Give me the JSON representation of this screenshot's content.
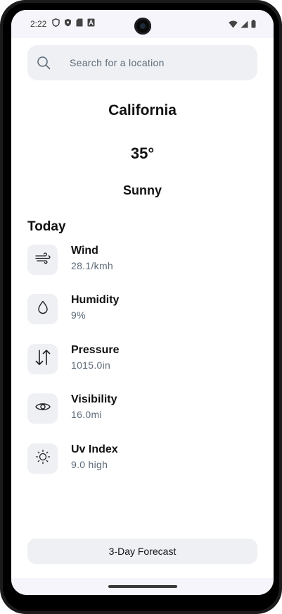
{
  "status_bar": {
    "time": "2:22",
    "left_icons": [
      "shield-outline-icon",
      "shield-filled-icon",
      "sd-card-icon",
      "font-a-icon"
    ],
    "right_icons": [
      "wifi-icon",
      "cell-signal-icon",
      "battery-icon"
    ]
  },
  "search": {
    "placeholder": "Search for a location",
    "value": "",
    "icon": "search-icon"
  },
  "weather": {
    "location": "California",
    "temperature": "35°",
    "condition": "Sunny"
  },
  "today": {
    "heading": "Today",
    "metrics": [
      {
        "label": "Wind",
        "value": "28.1/kmh",
        "icon": "wind-icon"
      },
      {
        "label": "Humidity",
        "value": "9%",
        "icon": "droplet-icon"
      },
      {
        "label": "Pressure",
        "value": "1015.0in",
        "icon": "up-down-arrows-icon"
      },
      {
        "label": "Visibility",
        "value": "16.0mi",
        "icon": "eye-icon"
      },
      {
        "label": "Uv Index",
        "value": "9.0 high",
        "icon": "sun-icon"
      }
    ]
  },
  "forecast_button": {
    "label": "3-Day Forecast"
  },
  "colors": {
    "background": "#ffffff",
    "card": "#eef0f4",
    "secondary_text": "#5d6b78",
    "primary_text": "#111111"
  }
}
